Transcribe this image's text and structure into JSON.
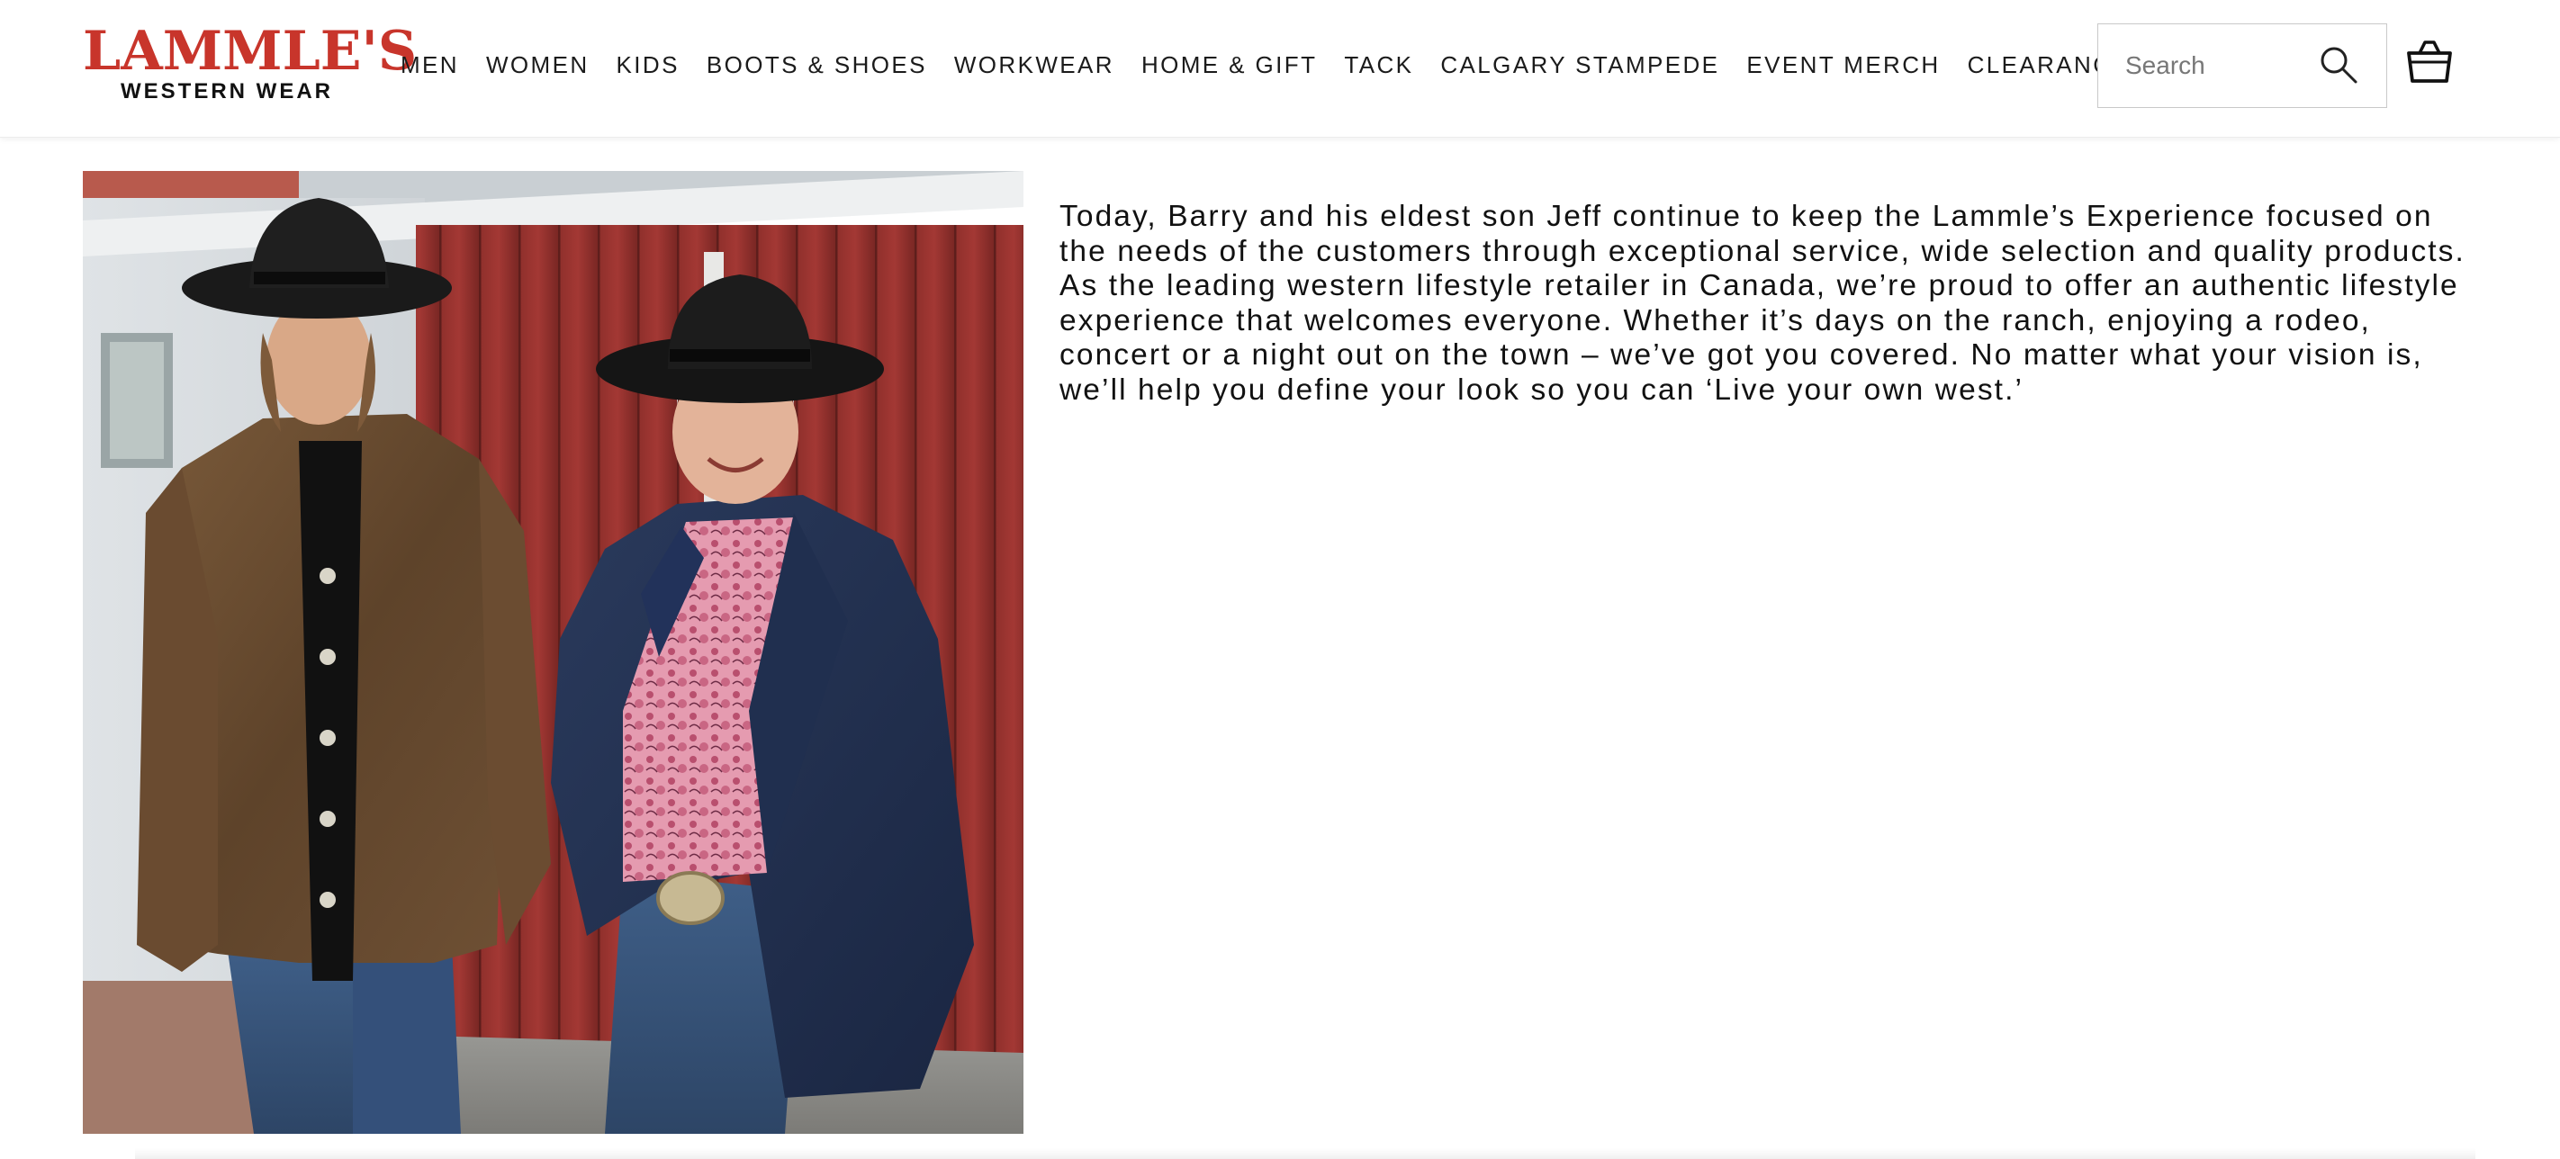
{
  "header": {
    "logo": {
      "main": "LAMMLE'S",
      "sub": "WESTERN WEAR"
    },
    "nav": [
      {
        "label": "MEN"
      },
      {
        "label": "WOMEN"
      },
      {
        "label": "KIDS"
      },
      {
        "label": "BOOTS & SHOES"
      },
      {
        "label": "WORKWEAR"
      },
      {
        "label": "HOME & GIFT"
      },
      {
        "label": "TACK"
      },
      {
        "label": "CALGARY STAMPEDE"
      },
      {
        "label": "EVENT MERCH"
      },
      {
        "label": "CLEARANCE"
      }
    ],
    "search": {
      "placeholder": "Search",
      "value": ""
    },
    "icons": {
      "search": "search-icon",
      "cart": "shopping-bag-icon"
    }
  },
  "main": {
    "about_text": "Today, Barry and his eldest son Jeff continue to keep the Lammle’s Experience focused on the needs of the customers through exceptional service, wide selection and quality products. As the leading western lifestyle retailer in Canada, we’re proud to offer an authentic lifestyle experience that welcomes everyone. Whether it’s days on the ranch, enjoying a rodeo, concert or a night out on the town – we’ve got you covered. No matter what your vision is, we’ll help you define your look so you can ‘Live your own west.’"
  },
  "colors": {
    "brand_red": "#c8352b",
    "text": "#111111",
    "border": "#c9c9c9"
  }
}
